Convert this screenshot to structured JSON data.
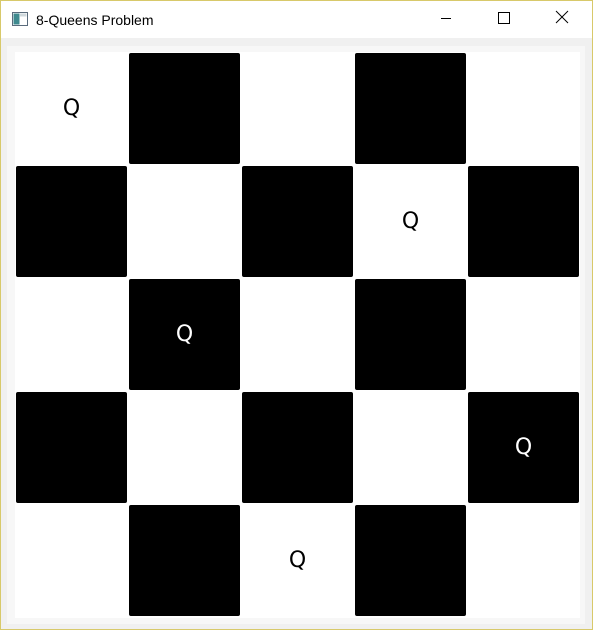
{
  "window": {
    "title": "8-Queens Problem",
    "icons": {
      "app": "app-window-icon",
      "minimize": "minimize-icon",
      "maximize": "maximize-icon",
      "close": "close-icon"
    }
  },
  "board": {
    "rows": 5,
    "cols": 5,
    "queen_symbol": "Q",
    "colors": {
      "dark": "#000000",
      "light": "#ffffff"
    },
    "queens": [
      {
        "row": 1,
        "col": 1
      },
      {
        "row": 2,
        "col": 4
      },
      {
        "row": 3,
        "col": 2
      },
      {
        "row": 4,
        "col": 5
      },
      {
        "row": 5,
        "col": 3
      }
    ]
  }
}
